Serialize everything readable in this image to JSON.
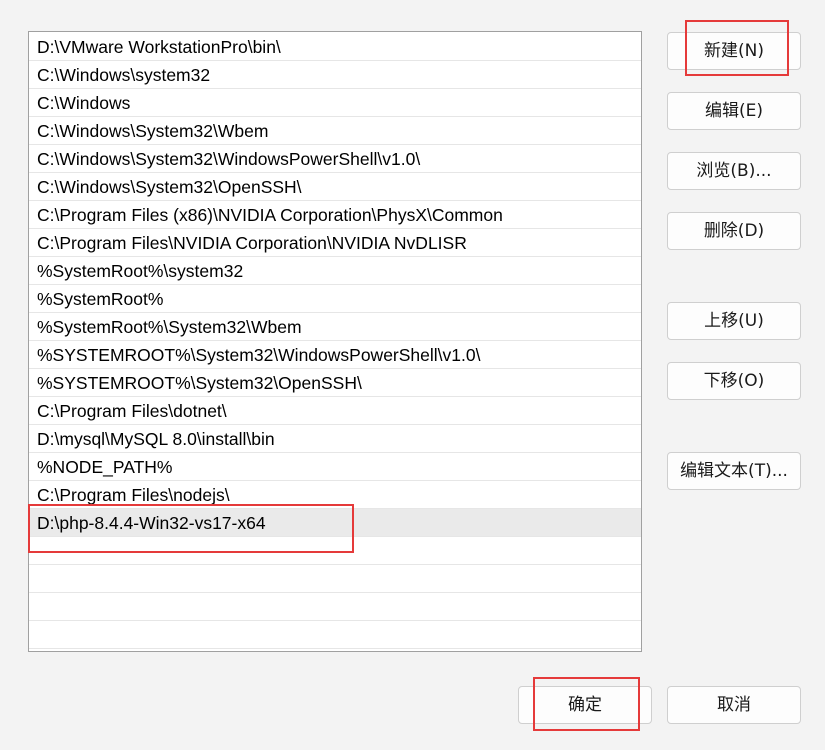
{
  "paths": [
    "D:\\VMware WorkstationPro\\bin\\",
    "C:\\Windows\\system32",
    "C:\\Windows",
    "C:\\Windows\\System32\\Wbem",
    "C:\\Windows\\System32\\WindowsPowerShell\\v1.0\\",
    "C:\\Windows\\System32\\OpenSSH\\",
    "C:\\Program Files (x86)\\NVIDIA Corporation\\PhysX\\Common",
    "C:\\Program Files\\NVIDIA Corporation\\NVIDIA NvDLISR",
    "%SystemRoot%\\system32",
    "%SystemRoot%",
    "%SystemRoot%\\System32\\Wbem",
    "%SYSTEMROOT%\\System32\\WindowsPowerShell\\v1.0\\",
    "%SYSTEMROOT%\\System32\\OpenSSH\\",
    "C:\\Program Files\\dotnet\\",
    "D:\\mysql\\MySQL 8.0\\install\\bin",
    "%NODE_PATH%",
    "C:\\Program Files\\nodejs\\",
    "D:\\php-8.4.4-Win32-vs17-x64"
  ],
  "selected_index": 17,
  "buttons": {
    "new": "新建(N)",
    "edit": "编辑(E)",
    "browse": "浏览(B)...",
    "delete": "删除(D)",
    "move_up": "上移(U)",
    "move_down": "下移(O)",
    "edit_text": "编辑文本(T)...",
    "ok": "确定",
    "cancel": "取消"
  },
  "colors": {
    "highlight": "#e53a3a",
    "selection": "#eaeaea"
  }
}
